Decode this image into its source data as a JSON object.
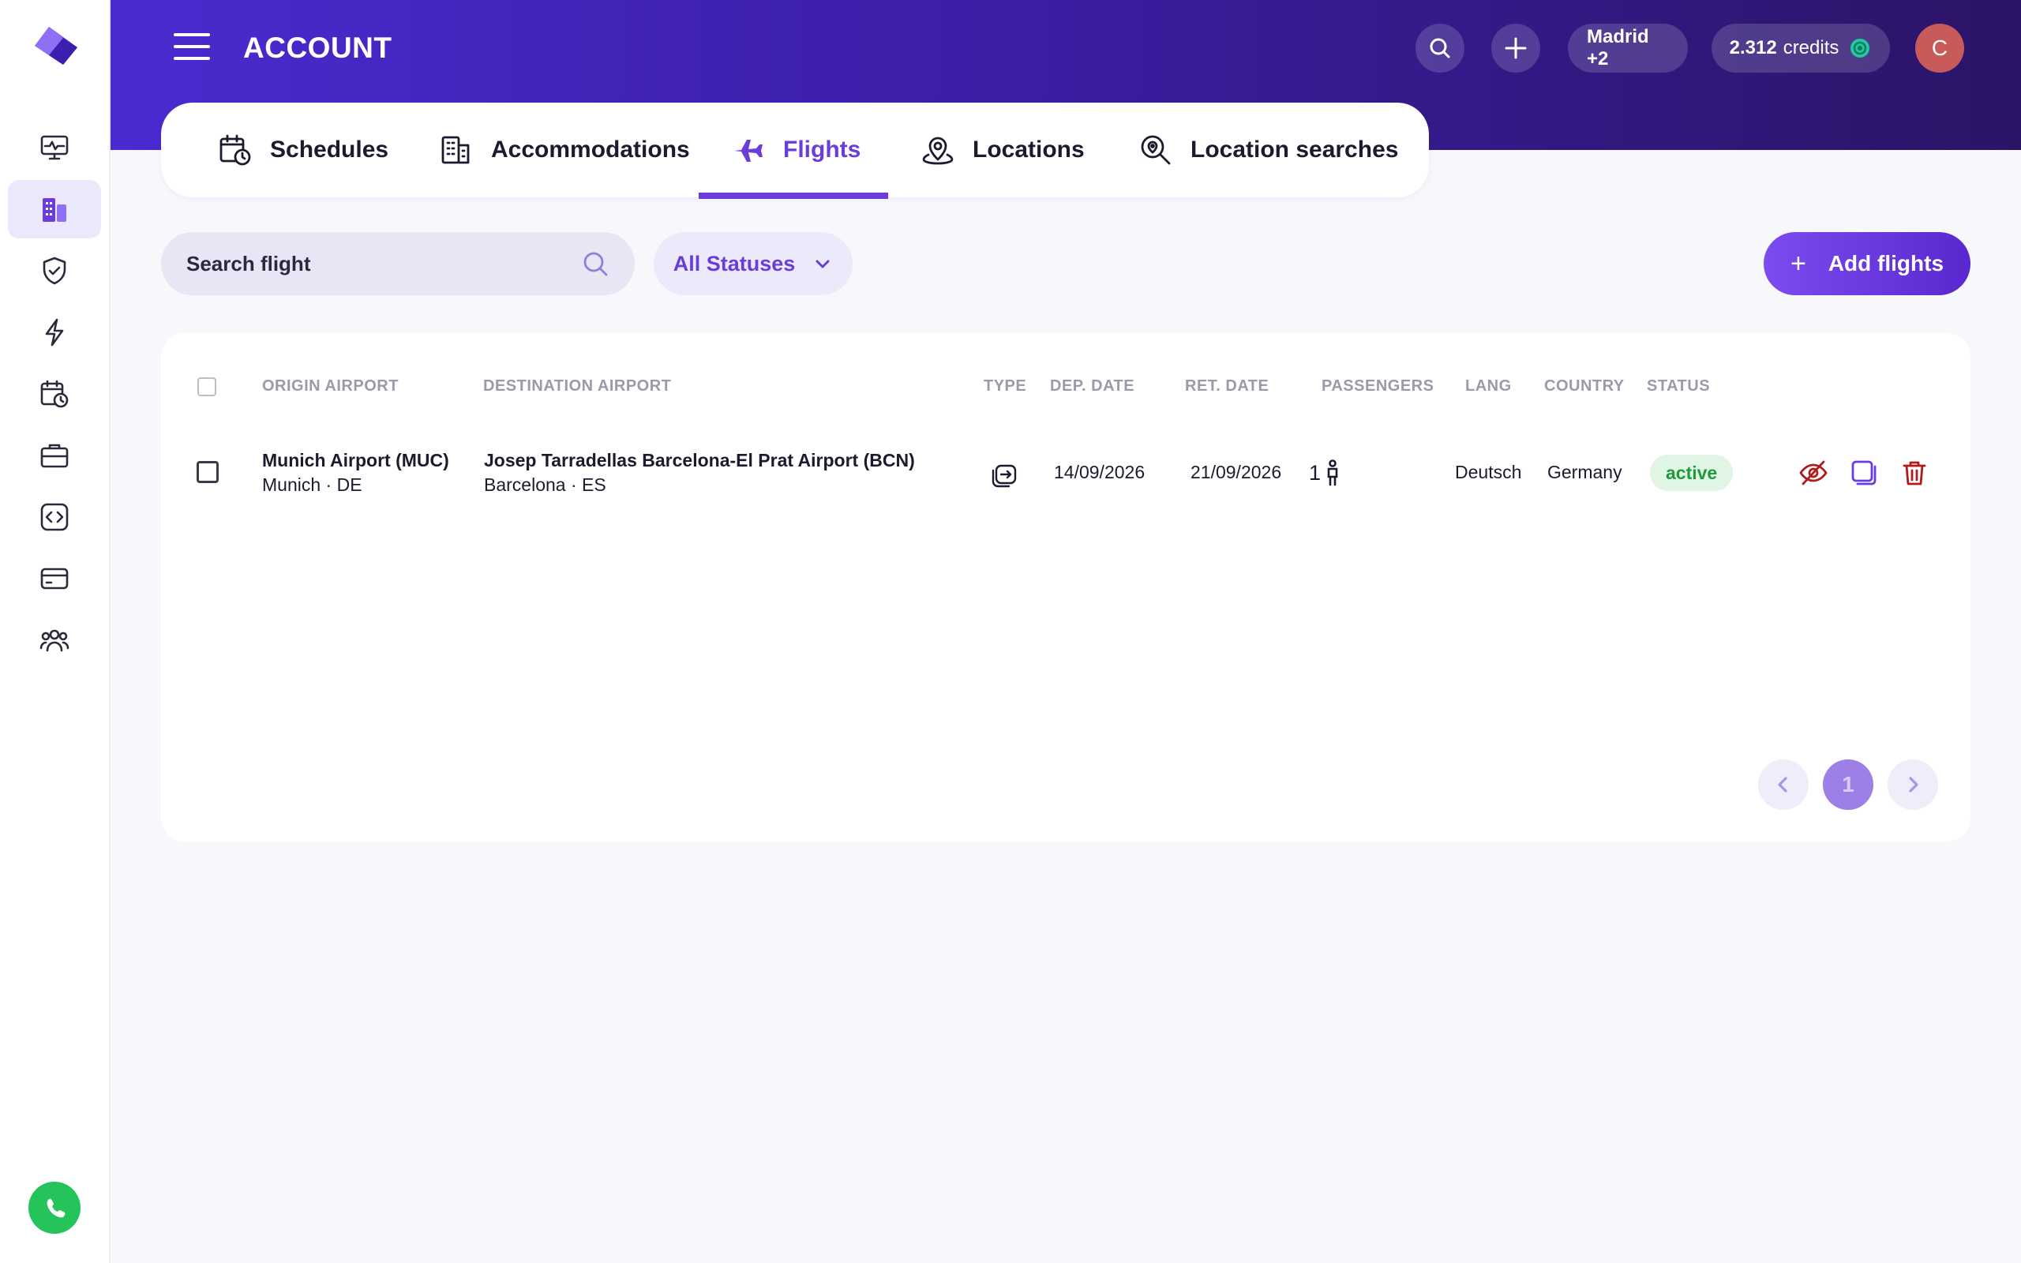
{
  "header": {
    "title": "ACCOUNT",
    "location_pill": "Madrid +2",
    "credits_value": "2.312",
    "credits_label": "credits",
    "avatar_initial": "C"
  },
  "sidebar": {
    "items": [
      {
        "icon": "monitor-pulse-icon",
        "active": false
      },
      {
        "icon": "buildings-icon",
        "active": true
      },
      {
        "icon": "shield-check-icon",
        "active": false
      },
      {
        "icon": "lightning-icon",
        "active": false
      },
      {
        "icon": "calendar-clock-icon",
        "active": false
      },
      {
        "icon": "briefcase-icon",
        "active": false
      },
      {
        "icon": "code-icon",
        "active": false
      },
      {
        "icon": "credit-card-icon",
        "active": false
      },
      {
        "icon": "users-icon",
        "active": false
      }
    ]
  },
  "tabs": [
    {
      "label": "Schedules",
      "icon": "calendar-clock-icon",
      "active": false
    },
    {
      "label": "Accommodations",
      "icon": "building-icon",
      "active": false
    },
    {
      "label": "Flights",
      "icon": "airplane-icon",
      "active": true
    },
    {
      "label": "Locations",
      "icon": "map-pin-icon",
      "active": false
    },
    {
      "label": "Location searches",
      "icon": "search-location-icon",
      "active": false
    }
  ],
  "controls": {
    "search_placeholder": "Search flight",
    "status_filter": "All Statuses",
    "add_button": "Add flights"
  },
  "table": {
    "columns": [
      "ORIGIN AIRPORT",
      "DESTINATION AIRPORT",
      "TYPE",
      "DEP. DATE",
      "RET. DATE",
      "PASSENGERS",
      "LANG",
      "COUNTRY",
      "STATUS"
    ],
    "rows": [
      {
        "origin_name": "Munich Airport (MUC)",
        "origin_sub": "Munich · DE",
        "destination_name": "Josep Tarradellas Barcelona-El Prat Airport (BCN)",
        "destination_sub": "Barcelona · ES",
        "type_icon": "round-trip-icon",
        "dep_date": "14/09/2026",
        "ret_date": "21/09/2026",
        "passengers": "1",
        "lang": "Deutsch",
        "country": "Germany",
        "status": "active"
      }
    ]
  },
  "pagination": {
    "current_page": "1"
  },
  "colors": {
    "accent": "#6a3ddb",
    "header_start": "#4a2bd0",
    "header_end": "#2b1466",
    "status_active": "#1f9a3b",
    "danger": "#b01c1c",
    "whatsapp": "#25c45a"
  }
}
